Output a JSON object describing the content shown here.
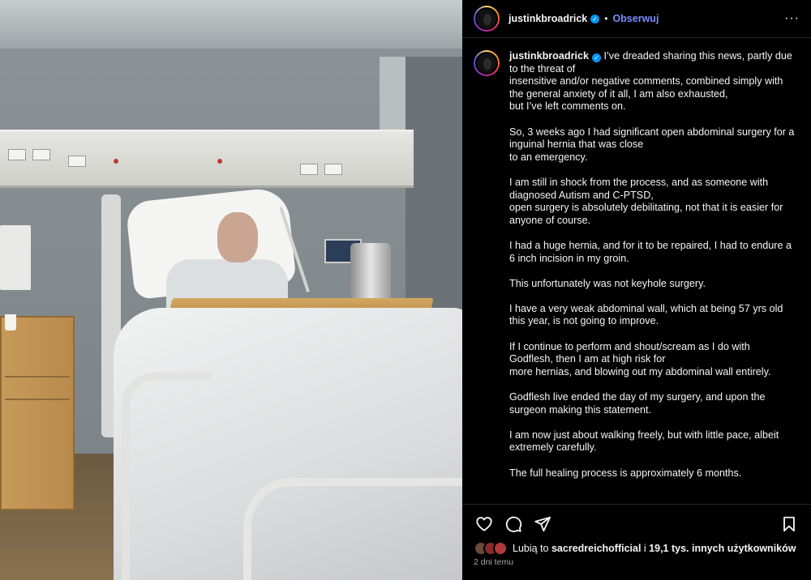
{
  "post": {
    "username": "justinkbroadrick",
    "follow_label": "Obserwuj",
    "separator": "•",
    "more_glyph": "···",
    "verified_glyph": "✓",
    "image_description": "Man in hospital bed eating a meal"
  },
  "caption": {
    "paragraphs": [
      "I’ve dreaded sharing this news, partly due to the threat of\ninsensitive and/or negative comments, combined simply with the general anxiety of it all, I am also exhausted,\nbut I’ve left comments on.",
      "So, 3 weeks ago I had significant open abdominal surgery for a inguinal hernia that was close\nto an emergency.",
      "I am still in shock from the process, and as someone with diagnosed Autism and C-PTSD,\nopen surgery is absolutely debilitating, not that it is easier for anyone of course.",
      "I had a huge hernia, and for it to be repaired, I had to endure a 6 inch incision in my groin.",
      "This unfortunately was not keyhole surgery.",
      "I have a very weak abdominal wall, which at being 57 yrs old this year, is not going to improve.",
      "If I continue to perform and shout/scream as I do with Godflesh, then I am at high risk for\nmore hernias, and blowing out my abdominal wall entirely.",
      "Godflesh live ended the day of my surgery, and upon the surgeon making this statement.",
      "I am now just about walking freely, but with little pace, albeit extremely carefully.",
      "The full healing process is approximately 6 months."
    ]
  },
  "actions": {
    "like_icon": "heart-icon",
    "comment_icon": "comment-icon",
    "share_icon": "share-icon",
    "save_icon": "bookmark-icon"
  },
  "likes": {
    "prefix": "Lubią to ",
    "user": "sacredreichofficial",
    "middle": " i ",
    "count": "19,1 tys. innych użytkowników"
  },
  "timestamp": "2 dni temu",
  "colors": {
    "background": "#000000",
    "link": "#7a8cff",
    "verified": "#0095f6",
    "muted": "#a8a8a8"
  }
}
